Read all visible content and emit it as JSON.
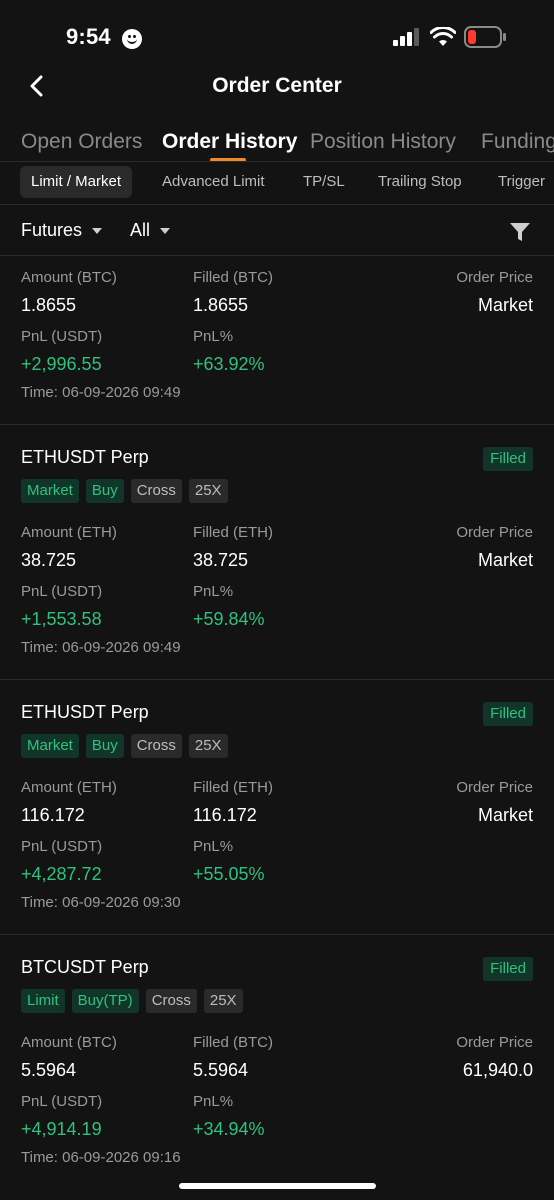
{
  "status_bar": {
    "time": "9:54"
  },
  "header": {
    "title": "Order Center"
  },
  "main_tabs": [
    "Open Orders",
    "Order History",
    "Position History",
    "Funding"
  ],
  "sub_tabs": [
    "Limit / Market",
    "Advanced Limit",
    "TP/SL",
    "Trailing Stop",
    "Trigger"
  ],
  "filters": {
    "market": "Futures",
    "side": "All"
  },
  "labels": {
    "order_price": "Order Price",
    "pnl_usdt": "PnL (USDT)",
    "pnl_pct": "PnL%"
  },
  "orders": [
    {
      "amount_label": "Amount (BTC)",
      "amount": "1.8655",
      "filled_label": "Filled (BTC)",
      "filled": "1.8655",
      "order_price": "Market",
      "pnl": "+2,996.55",
      "pnl_pct": "+63.92%",
      "time": "Time: 06-09-2026 09:49"
    },
    {
      "pair": "ETHUSDT Perp",
      "status": "Filled",
      "tags": [
        "Market",
        "Buy",
        "Cross",
        "25X"
      ],
      "amount_label": "Amount (ETH)",
      "amount": "38.725",
      "filled_label": "Filled (ETH)",
      "filled": "38.725",
      "order_price": "Market",
      "pnl": "+1,553.58",
      "pnl_pct": "+59.84%",
      "time": "Time: 06-09-2026 09:49"
    },
    {
      "pair": "ETHUSDT Perp",
      "status": "Filled",
      "tags": [
        "Market",
        "Buy",
        "Cross",
        "25X"
      ],
      "amount_label": "Amount (ETH)",
      "amount": "116.172",
      "filled_label": "Filled (ETH)",
      "filled": "116.172",
      "order_price": "Market",
      "pnl": "+4,287.72",
      "pnl_pct": "+55.05%",
      "time": "Time: 06-09-2026 09:30"
    },
    {
      "pair": "BTCUSDT Perp",
      "status": "Filled",
      "tags": [
        "Limit",
        "Buy(TP)",
        "Cross",
        "25X"
      ],
      "amount_label": "Amount (BTC)",
      "amount": "5.5964",
      "filled_label": "Filled (BTC)",
      "filled": "5.5964",
      "order_price": "61,940.0",
      "pnl": "+4,914.19",
      "pnl_pct": "+34.94%",
      "time": "Time: 06-09-2026 09:16"
    }
  ],
  "colors": {
    "accent": "#f08a24",
    "positive": "#2ec27e",
    "background": "#131313"
  }
}
